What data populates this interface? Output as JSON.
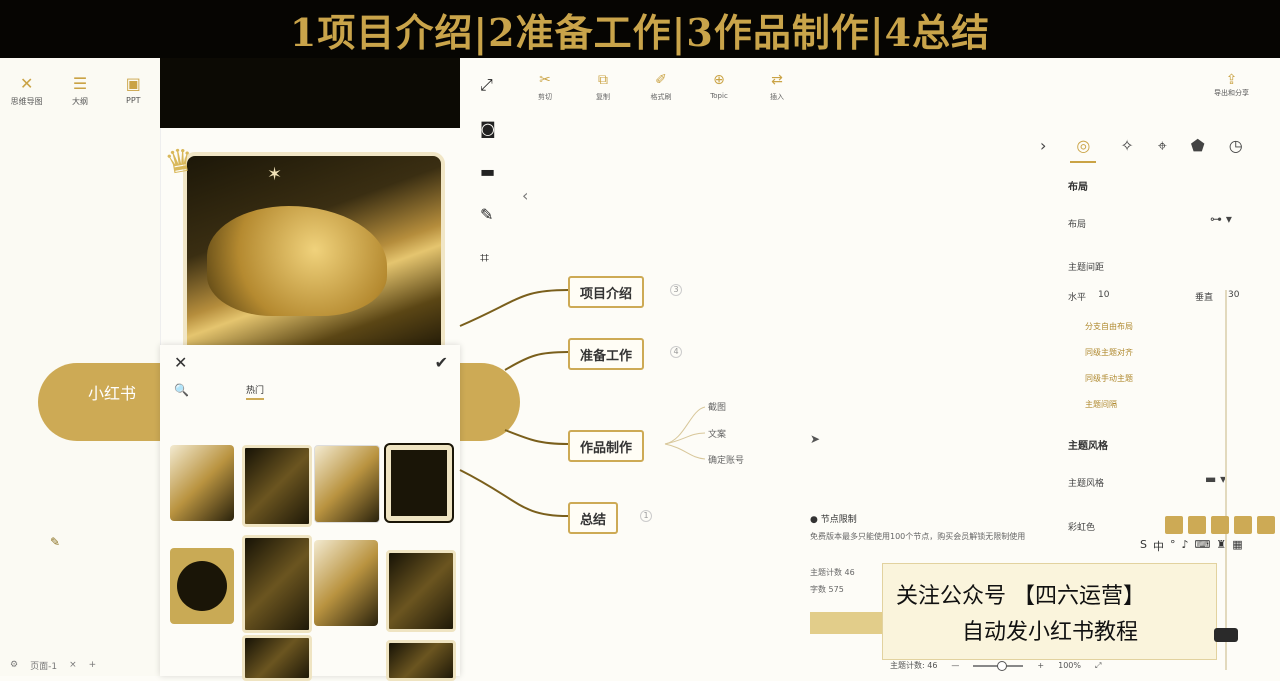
{
  "banner": {
    "title": "1项目介绍|2准备工作|3作品制作|4总结"
  },
  "left_panel": {
    "tools": [
      {
        "icon": "cross-icon",
        "label": "思维导图"
      },
      {
        "icon": "outline-icon",
        "label": "大纲"
      },
      {
        "icon": "ppt-icon",
        "label": "PPT"
      }
    ],
    "bottom": {
      "page_label": "页面-1"
    }
  },
  "central_node": {
    "label": "小红书"
  },
  "popup": {
    "tab_label": "热门"
  },
  "toolbar": {
    "items": [
      {
        "icon": "scissors-icon",
        "label": "剪切"
      },
      {
        "icon": "copy-icon",
        "label": "复制"
      },
      {
        "icon": "brush-icon",
        "label": "格式刷"
      },
      {
        "icon": "topic-icon",
        "label": "Topic"
      },
      {
        "icon": "insert-icon",
        "label": "插入"
      }
    ],
    "export_label": "导出和分享"
  },
  "mindmap": {
    "branches": [
      {
        "label": "项目介绍",
        "count": "3"
      },
      {
        "label": "准备工作",
        "count": "4"
      },
      {
        "label": "作品制作",
        "count": ""
      },
      {
        "label": "总结",
        "count": "1"
      }
    ],
    "subitems": [
      "截图",
      "文案",
      "确定账号"
    ]
  },
  "right_panel": {
    "section_layout": "布局",
    "layout_label": "布局",
    "topic_spacing": "主题间距",
    "horizontal_label": "水平",
    "horizontal_value": "10",
    "vertical_label": "垂直",
    "vertical_value": "30",
    "links": [
      "分支自由布局",
      "同级主题对齐",
      "同级手动主题",
      "主题间隔"
    ],
    "section_style": "主题风格",
    "style_label": "主题风格",
    "color_label": "彩虹色"
  },
  "node_info": {
    "title": "节点限制",
    "description": "免费版本最多只能使用100个节点，购买会员解锁无限制使用",
    "topic_count_label": "主题计数",
    "topic_count_value": "46",
    "char_label": "字数",
    "char_value": "575"
  },
  "watermark": {
    "line1": "关注公众号 【四六运营】",
    "line2": "自动发小红书教程"
  },
  "statusbar": {
    "topic_count": "主题计数: 46",
    "zoom": "100%"
  }
}
